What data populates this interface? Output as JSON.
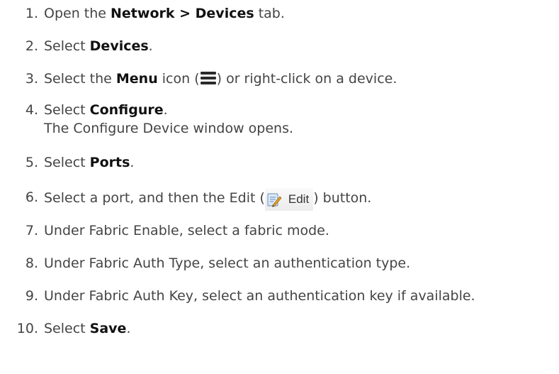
{
  "steps": [
    {
      "number": "1.",
      "pre": "Open the ",
      "bold": "Network > Devices",
      "post": " tab."
    },
    {
      "number": "2.",
      "pre": "Select ",
      "bold": "Devices",
      "post": "."
    },
    {
      "number": "3.",
      "pre": "Select the ",
      "bold": "Menu",
      "post_a": " icon (",
      "post_b": ") or right-click on a device."
    },
    {
      "number": "4.",
      "pre": "Select ",
      "bold": "Configure",
      "post": ".",
      "sub": "The Configure Device window opens."
    },
    {
      "number": "5.",
      "pre": "Select ",
      "bold": "Ports",
      "post": "."
    },
    {
      "number": "6.",
      "pre": "Select a port, and then the Edit (",
      "button_label": "Edit",
      "post": ") button."
    },
    {
      "number": "7.",
      "text": "Under Fabric Enable, select a fabric mode."
    },
    {
      "number": "8.",
      "text": "Under Fabric Auth Type, select an authentication type."
    },
    {
      "number": "9.",
      "text": "Under Fabric Auth Key, select an authentication key if available."
    },
    {
      "number": "10.",
      "pre": "Select ",
      "bold": "Save",
      "post": "."
    }
  ],
  "colors": {
    "text": "#444444",
    "bold": "#111111",
    "menu_icon": "#2a2a2a"
  },
  "icons": {
    "menu": "hamburger-menu-icon",
    "edit": "edit-pencil-icon"
  }
}
